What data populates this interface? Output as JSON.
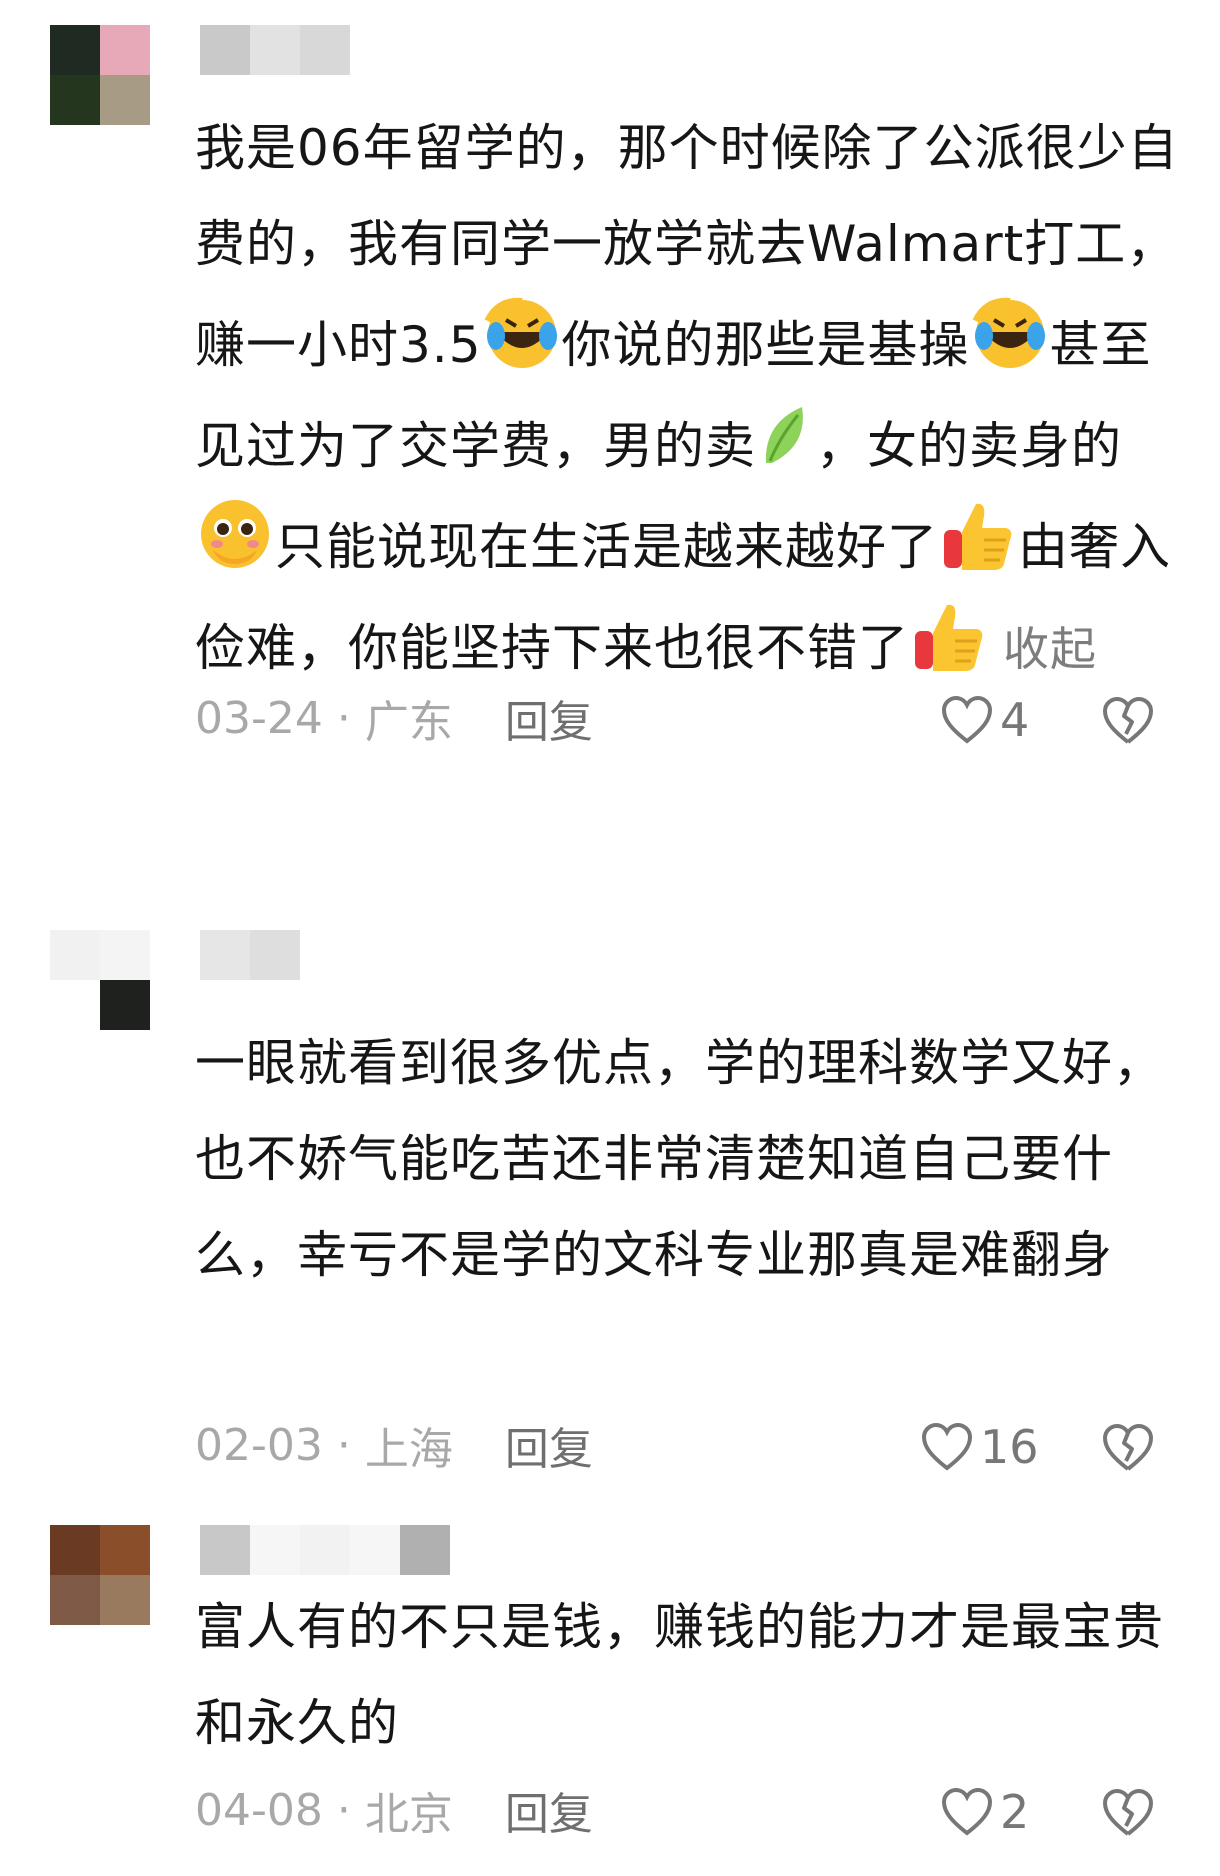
{
  "comments": [
    {
      "segments": [
        "我是06年留学的，那个时候除了公派很少自费的，我有同学一放学就去Walmart打工，赚一小时3.5",
        "你说的那些是基操",
        "甚至见过为了交学费，男的卖",
        "，女的卖身的",
        "只能说现在生活是越来越好了",
        "由奢入俭难，你能坚持下来也很不错了"
      ],
      "emojis": [
        "laugh-cry-emoji",
        "laugh-cry-emoji",
        "leaf-emoji",
        "pleading-emoji",
        "thumbs-up-emoji",
        "thumbs-up-emoji"
      ],
      "collapse_label": "收起",
      "date": "03-24",
      "separator": "·",
      "location": "广东",
      "reply_label": "回复",
      "likes": "4"
    },
    {
      "text": "一眼就看到很多优点，学的理科数学又好，也不娇气能吃苦还非常清楚知道自己要什么，幸亏不是学的文科专业那真是难翻身",
      "date": "02-03",
      "separator": "·",
      "location": "上海",
      "reply_label": "回复",
      "likes": "16"
    },
    {
      "text": "富人有的不只是钱，赚钱的能力才是最宝贵和永久的",
      "date": "04-08",
      "separator": "·",
      "location": "北京",
      "reply_label": "回复",
      "likes": "2"
    }
  ],
  "colors": {
    "text": "#161616",
    "meta": "#a8a8a8",
    "reply": "#6f6f6f",
    "icon": "#777777"
  }
}
